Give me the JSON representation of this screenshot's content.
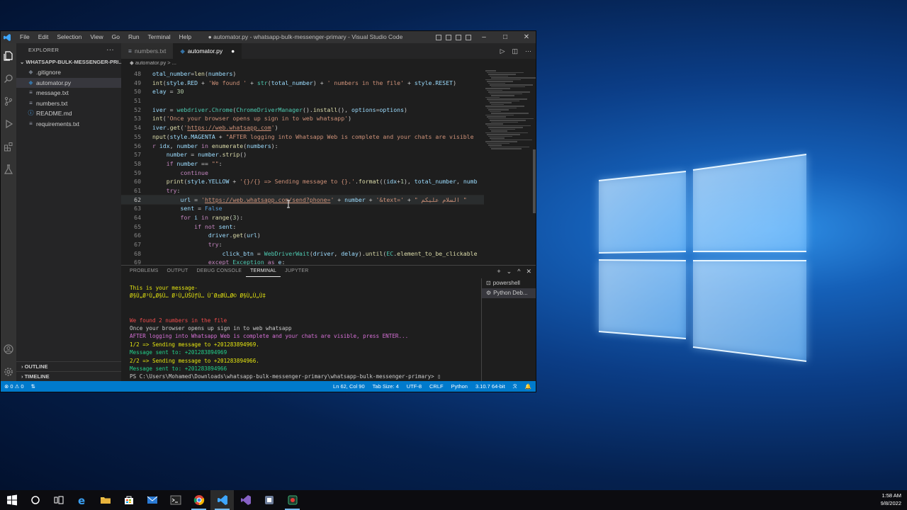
{
  "window": {
    "title": "● automator.py - whatsapp-bulk-messenger-primary - Visual Studio Code",
    "menu": [
      "File",
      "Edit",
      "Selection",
      "View",
      "Go",
      "Run",
      "Terminal",
      "Help"
    ],
    "controls": {
      "minimize": "–",
      "maximize": "□",
      "close": "✕"
    }
  },
  "sidebar": {
    "header": "EXPLORER",
    "more": "···",
    "folder": "WHATSAPP-BULK-MESSENGER-PRI...",
    "files": [
      {
        "name": ".gitignore",
        "icon": "gitignore-icon",
        "glyph": "◆",
        "color": "#6e7681"
      },
      {
        "name": "automator.py",
        "icon": "python-file-icon",
        "glyph": "◆",
        "color": "#3572a5"
      },
      {
        "name": "message.txt",
        "icon": "text-file-icon",
        "glyph": "≡",
        "color": "#9da5b4"
      },
      {
        "name": "numbers.txt",
        "icon": "text-file-icon",
        "glyph": "≡",
        "color": "#9da5b4"
      },
      {
        "name": "README.md",
        "icon": "info-icon",
        "glyph": "ⓘ",
        "color": "#4aa5f0"
      },
      {
        "name": "requirements.txt",
        "icon": "text-file-icon",
        "glyph": "≡",
        "color": "#9da5b4"
      }
    ],
    "outline": "OUTLINE",
    "timeline": "TIMELINE"
  },
  "editor": {
    "tabs": [
      {
        "label": "numbers.txt",
        "active": false
      },
      {
        "label": "automator.py",
        "active": true,
        "dirty": "●"
      }
    ],
    "breadcrumb": "◆ automator.py > ...",
    "lines": [
      {
        "n": "48",
        "html": "<span style='color:#9cdcfe'>otal_number</span>=<span style='color:#dcdcaa'>len</span>(<span style='color:#9cdcfe'>numbers</span>)"
      },
      {
        "n": "49",
        "html": "<span style='color:#dcdcaa'>int</span>(<span style='color:#9cdcfe'>style</span>.<span style='color:#9cdcfe'>RED</span> + <span style='color:#ce9178'>'We found '</span> + <span style='color:#4ec9b0'>str</span>(<span style='color:#9cdcfe'>total_number</span>) + <span style='color:#ce9178'>' numbers in the file'</span> + <span style='color:#9cdcfe'>style</span>.<span style='color:#9cdcfe'>RESET</span>)"
      },
      {
        "n": "50",
        "html": "<span style='color:#9cdcfe'>elay</span> = <span style='color:#b5cea8'>30</span>"
      },
      {
        "n": "51",
        "html": ""
      },
      {
        "n": "52",
        "html": "<span style='color:#9cdcfe'>iver</span> = <span style='color:#4ec9b0'>webdriver</span>.<span style='color:#4ec9b0'>Chrome</span>(<span style='color:#4ec9b0'>ChromeDriverManager</span>().<span style='color:#dcdcaa'>install</span>(), <span style='color:#9cdcfe'>options</span>=<span style='color:#9cdcfe'>options</span>)"
      },
      {
        "n": "53",
        "html": "<span style='color:#dcdcaa'>int</span>(<span style='color:#ce9178'>'Once your browser opens up sign in to web whatsapp'</span>)"
      },
      {
        "n": "54",
        "html": "<span style='color:#9cdcfe'>iver</span>.<span style='color:#dcdcaa'>get</span>(<span style='color:#ce9178'>'<u>https://web.whatsapp.com</u>'</span>)"
      },
      {
        "n": "55",
        "html": "<span style='color:#dcdcaa'>nput</span>(<span style='color:#9cdcfe'>style</span>.<span style='color:#9cdcfe'>MAGENTA</span> + <span style='color:#ce9178'>\"AFTER logging into Whatsapp Web is complete and your chats are visible</span>"
      },
      {
        "n": "56",
        "html": "<span style='color:#c586c0'>r</span> <span style='color:#9cdcfe'>idx</span>, <span style='color:#9cdcfe'>number</span> <span style='color:#c586c0'>in</span> <span style='color:#dcdcaa'>enumerate</span>(<span style='color:#9cdcfe'>numbers</span>):"
      },
      {
        "n": "57",
        "html": "    <span style='color:#9cdcfe'>number</span> = <span style='color:#9cdcfe'>number</span>.<span style='color:#dcdcaa'>strip</span>()"
      },
      {
        "n": "58",
        "html": "    <span style='color:#c586c0'>if</span> <span style='color:#9cdcfe'>number</span> == <span style='color:#ce9178'>\"\"</span>:"
      },
      {
        "n": "59",
        "html": "        <span style='color:#c586c0'>continue</span>"
      },
      {
        "n": "60",
        "html": "    <span style='color:#dcdcaa'>print</span>(<span style='color:#9cdcfe'>style</span>.<span style='color:#9cdcfe'>YELLOW</span> + <span style='color:#ce9178'>'{}/{} => Sending message to {}.'</span>.<span style='color:#dcdcaa'>format</span>((<span style='color:#9cdcfe'>idx</span>+<span style='color:#b5cea8'>1</span>), <span style='color:#9cdcfe'>total_number</span>, <span style='color:#9cdcfe'>numb</span>"
      },
      {
        "n": "61",
        "html": "    <span style='color:#c586c0'>try</span>:"
      },
      {
        "n": "62",
        "html": "        <span style='color:#9cdcfe'>url</span> = <span style='color:#ce9178'>'<u>https://web.whatsapp.com/send?phone=</u>'</span> + <span style='color:#9cdcfe'>number</span> + <span style='color:#ce9178'>'&amp;text='</span> + <span style='color:#ce9178'>\" السلام عليكم \"</span>"
      },
      {
        "n": "63",
        "html": "        <span style='color:#9cdcfe'>sent</span> = <span style='color:#569cd6'>False</span>"
      },
      {
        "n": "64",
        "html": "        <span style='color:#c586c0'>for</span> <span style='color:#9cdcfe'>i</span> <span style='color:#c586c0'>in</span> <span style='color:#dcdcaa'>range</span>(<span style='color:#b5cea8'>3</span>):"
      },
      {
        "n": "65",
        "html": "            <span style='color:#c586c0'>if not</span> <span style='color:#9cdcfe'>sent</span>:"
      },
      {
        "n": "66",
        "html": "                <span style='color:#9cdcfe'>driver</span>.<span style='color:#dcdcaa'>get</span>(<span style='color:#9cdcfe'>url</span>)"
      },
      {
        "n": "67",
        "html": "                <span style='color:#c586c0'>try</span>:"
      },
      {
        "n": "68",
        "html": "                    <span style='color:#9cdcfe'>click_btn</span> = <span style='color:#4ec9b0'>WebDriverWait</span>(<span style='color:#9cdcfe'>driver</span>, <span style='color:#9cdcfe'>delay</span>).<span style='color:#dcdcaa'>until</span>(<span style='color:#4ec9b0'>EC</span>.<span style='color:#dcdcaa'>element_to_be_clickable</span>"
      },
      {
        "n": "69",
        "html": "                <span style='color:#c586c0'>except</span> <span style='color:#4ec9b0'>Exception</span> <span style='color:#c586c0'>as</span> <span style='color:#9cdcfe'>e</span>:"
      }
    ]
  },
  "panel": {
    "tabs": [
      "PROBLEMS",
      "OUTPUT",
      "DEBUG CONSOLE",
      "TERMINAL",
      "JUPYTER"
    ],
    "active_tab": "TERMINAL",
    "controls": [
      "+",
      "⌄",
      "^",
      "✕"
    ],
    "terminal_lines": [
      {
        "text": "This is your message-",
        "color": "#e5e510"
      },
      {
        "text": "Ø§Ù„Ø³Ù„Ø§Ù… Ø¹Ù„ÙŠÙƒÙ… ÙˆØ±Ø­Ù…Ø© Ø§Ù„Ù„Ù‡",
        "color": "#e5e510"
      },
      {
        "text": "",
        "color": "#ccc"
      },
      {
        "text": "",
        "color": "#ccc"
      },
      {
        "text": "We found 2 numbers in the file",
        "color": "#f14c4c"
      },
      {
        "text": "Once your browser opens up sign in to web whatsapp",
        "color": "#cccccc"
      },
      {
        "text": "AFTER logging into Whatsapp Web is complete and your chats are visible, press ENTER...",
        "color": "#d670d6"
      },
      {
        "text": "1/2 => Sending message to +201283894969.",
        "color": "#e5e510"
      },
      {
        "text": "Message sent to: +201283894969",
        "color": "#23d18b"
      },
      {
        "text": "2/2 => Sending message to +201283894966.",
        "color": "#e5e510"
      },
      {
        "text": "Message sent to: +201283894966",
        "color": "#23d18b"
      },
      {
        "text": "PS C:\\Users\\Mohamed\\Downloads\\whatsapp-bulk-messenger-primary\\whatsapp-bulk-messenger-primary> ▯",
        "color": "#cccccc"
      }
    ],
    "terminals": [
      {
        "label": "powershell",
        "glyph": "⊡"
      },
      {
        "label": "Python Deb...",
        "glyph": "⚙"
      }
    ]
  },
  "statusbar": {
    "errors": "⊗ 0 ⚠ 0",
    "sync": "⇅",
    "items": [
      "Ln 62, Col 90",
      "Tab Size: 4",
      "UTF-8",
      "CRLF",
      "Python",
      "3.10.7 64-bit",
      "ℛ",
      "🔔"
    ]
  },
  "taskbar": {
    "time": "1:58 AM",
    "date": "9/8/2022"
  },
  "colors": {
    "statusbar": "#007acc",
    "accent": "#76b9ed"
  }
}
